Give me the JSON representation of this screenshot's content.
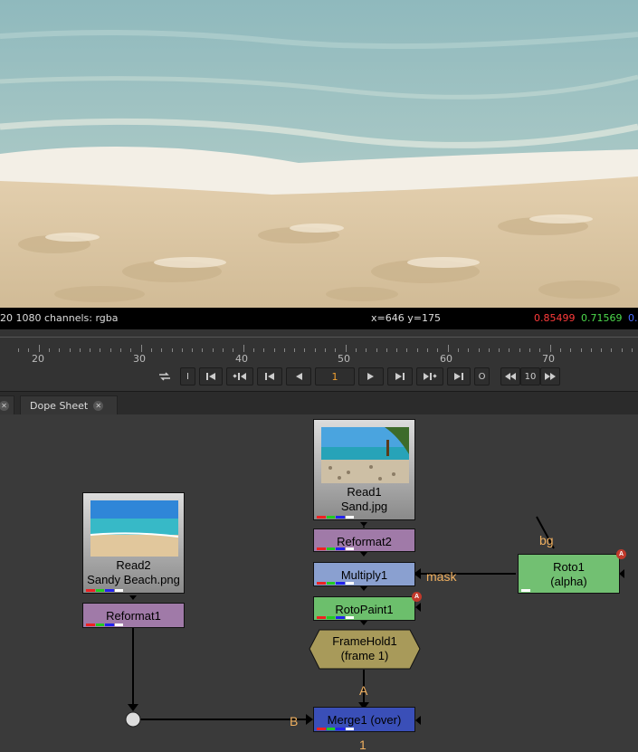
{
  "infobar": {
    "format": "20 1080 channels: rgba",
    "coords": "x=646 y=175",
    "r": "0.85499",
    "g": "0.71569",
    "b": "0.",
    "r_color": "#ff3b3b",
    "g_color": "#4cd94c",
    "b_color": "#4a6cff"
  },
  "timeline": {
    "ticks": [
      "20",
      "30",
      "40",
      "50",
      "60",
      "70"
    ],
    "current_frame": "1",
    "in_label": "I",
    "out_label": "O",
    "increment": "10"
  },
  "tabs": [
    {
      "label": "Dope Sheet"
    }
  ],
  "nodes": {
    "read2": {
      "line1": "Read2",
      "line2": "Sandy Beach.png"
    },
    "reformat1": {
      "label": "Reformat1"
    },
    "read1": {
      "line1": "Read1",
      "line2": "Sand.jpg"
    },
    "reformat2": {
      "label": "Reformat2"
    },
    "multiply1": {
      "label": "Multiply1"
    },
    "rotopaint1": {
      "label": "RotoPaint1"
    },
    "framehold1": {
      "line1": "FrameHold1",
      "line2": "(frame 1)"
    },
    "merge1": {
      "label": "Merge1 (over)"
    },
    "roto1": {
      "line1": "Roto1",
      "line2": "(alpha)"
    }
  },
  "edge_labels": {
    "bg": "bg",
    "mask": "mask",
    "a": "A",
    "b": "B",
    "one": "1"
  },
  "badge": "A",
  "colors": {
    "read": "#8a8a8a",
    "reformat": "#a07aa8",
    "multiply": "#8aa0d0",
    "rotopaint": "#6cbf6c",
    "framehold": "#a89a5a",
    "merge": "#3a4fb8",
    "roto": "#72c072"
  }
}
